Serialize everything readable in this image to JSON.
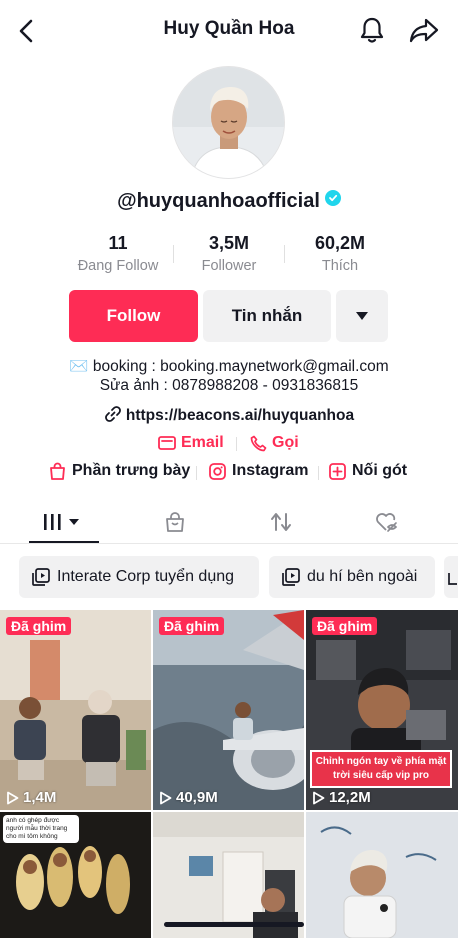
{
  "header": {
    "title": "Huy Quần Hoa"
  },
  "profile": {
    "username": "@huyquanhoaofficial",
    "stats": [
      {
        "value": "11",
        "label": "Đang Follow"
      },
      {
        "value": "3,5M",
        "label": "Follower"
      },
      {
        "value": "60,2M",
        "label": "Thích"
      }
    ],
    "buttons": {
      "follow": "Follow",
      "message": "Tin nhắn"
    },
    "bio": {
      "line1": "✉️ booking : booking.maynetwork@gmail.com",
      "line2": "Sửa ảnh :  0878988208 - 0931836815"
    },
    "link": "https://beacons.ai/huyquanhoa",
    "contacts": {
      "email": "Email",
      "call": "Gọi"
    },
    "shortcuts": {
      "showcase": "Phần trưng bày",
      "instagram": "Instagram",
      "duet": "Nối gót"
    }
  },
  "playlists": [
    {
      "label": "Interate Corp tuyển dụng"
    },
    {
      "label": "du hí bên ngoài"
    }
  ],
  "videos": [
    {
      "pinned": "Đã ghim",
      "views": "1,4M"
    },
    {
      "pinned": "Đã ghim",
      "views": "40,9M"
    },
    {
      "pinned": "Đã ghim",
      "views": "12,2M",
      "caption": "Chỉnh ngón tay về phía mặt trời siêu cấp vip pro"
    },
    {
      "bubble": "anh có ghép được người mẫu thời trang cho mì tôm không"
    },
    {},
    {}
  ],
  "colors": {
    "accent": "#fe2c55",
    "verified": "#20d5ec",
    "text": "#161823",
    "muted": "#8a8b91"
  }
}
